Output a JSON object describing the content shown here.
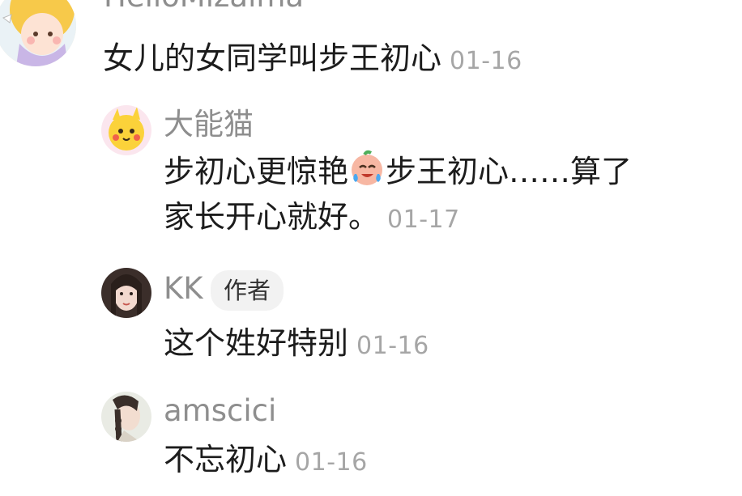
{
  "comments": [
    {
      "username": "HelloMizalma",
      "text": "女儿的女同学叫步王初心",
      "time": "01-16"
    },
    {
      "username": "大能猫",
      "text_part1": "步初心更惊艳",
      "emoji": "crying-laughing-face-emoji",
      "text_part2": "步王初心……算了",
      "text_line2": "家长开心就好。",
      "time": "01-17"
    },
    {
      "username": "KK",
      "badge": "作者",
      "text": "这个姓好特别",
      "time": "01-16"
    },
    {
      "username": "amscici",
      "text": "不忘初心",
      "time": "01-16"
    }
  ]
}
